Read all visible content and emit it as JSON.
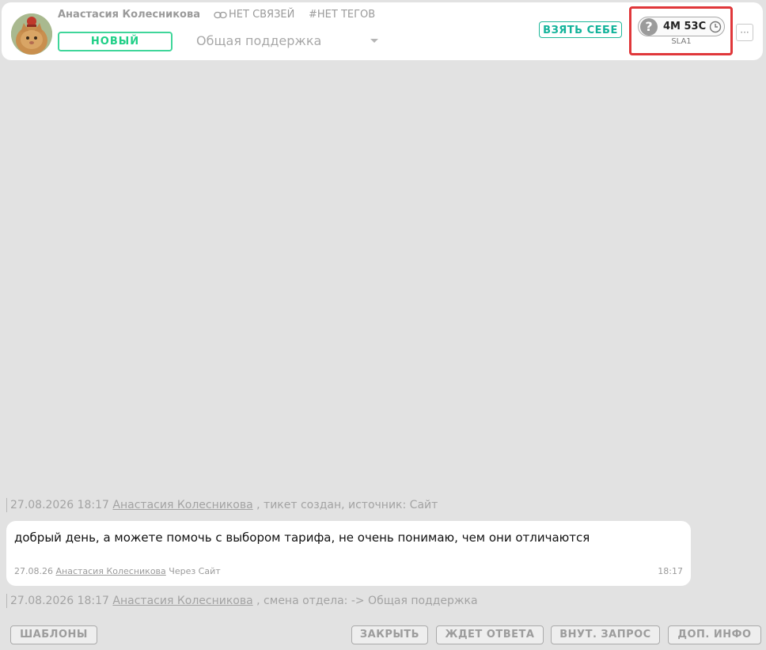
{
  "ticket": {
    "user_name": "Анастасия Колесникова",
    "links_label": "НЕТ СВЯЗЕЙ",
    "tags_label": "#НЕТ ТЕГОВ",
    "status": "НОВЫЙ",
    "department": "Общая поддержка",
    "take_button": "ВЗЯТЬ СЕБЕ",
    "sla": {
      "help": "?",
      "time": "4М 53С",
      "label": "SLA1"
    },
    "more_label": "···"
  },
  "timeline": {
    "created_event": {
      "datetime": "27.08.2026 18:17",
      "author": "Анастасия Колесникова",
      "text": ", тикет создан, источник: Сайт"
    },
    "message": {
      "text": "добрый день, а можете помочь с выбором тарифа, не очень понимаю, чем они отличаются",
      "date": "27.08.26",
      "author": "Анастасия Колесникова",
      "via": "Через Сайт",
      "time": "18:17"
    },
    "department_event": {
      "datetime": "27.08.2026 18:17",
      "author": "Анастасия Колесникова",
      "text": ", смена отдела: -> Общая поддержка"
    }
  },
  "actions": {
    "templates": "ШАБЛОНЫ",
    "close": "ЗАКРЫТЬ",
    "awaiting": "ЖДЕТ ОТВЕТА",
    "internal": "ВНУТ. ЗАПРОС",
    "more_info": "ДОП. ИНФО"
  },
  "colors": {
    "accent": "#1ecf86",
    "take_button": "#12b39a",
    "highlight": "#e0373a",
    "background": "#e2e2e2"
  }
}
